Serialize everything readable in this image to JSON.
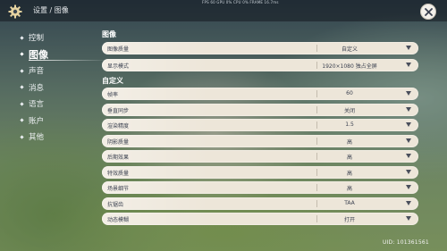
{
  "header": {
    "breadcrumb": "设置 / 图像",
    "fps_overlay": "FPS 60  GPU 0%  CPU 0%  FRAME 16.7ms"
  },
  "sidebar": {
    "items": [
      {
        "label": "控制",
        "active": false
      },
      {
        "label": "图像",
        "active": true
      },
      {
        "label": "声音",
        "active": false
      },
      {
        "label": "消息",
        "active": false
      },
      {
        "label": "语言",
        "active": false
      },
      {
        "label": "账户",
        "active": false
      },
      {
        "label": "其他",
        "active": false
      }
    ]
  },
  "sections": {
    "image": "图像",
    "custom": "自定义"
  },
  "settings_top": [
    {
      "label": "图像质量",
      "value": "自定义"
    },
    {
      "label": "显示模式",
      "value": "1920×1080 独占全屏"
    }
  ],
  "settings_custom": [
    {
      "label": "帧率",
      "value": "60"
    },
    {
      "label": "垂直同步",
      "value": "关闭"
    },
    {
      "label": "渲染精度",
      "value": "1.5"
    },
    {
      "label": "阴影质量",
      "value": "高"
    },
    {
      "label": "后期效果",
      "value": "高"
    },
    {
      "label": "特效质量",
      "value": "高"
    },
    {
      "label": "场景细节",
      "value": "高"
    },
    {
      "label": "抗锯齿",
      "value": "TAA"
    },
    {
      "label": "动态模糊",
      "value": "打开"
    }
  ],
  "footer": {
    "uid": "UID: 101361561"
  }
}
